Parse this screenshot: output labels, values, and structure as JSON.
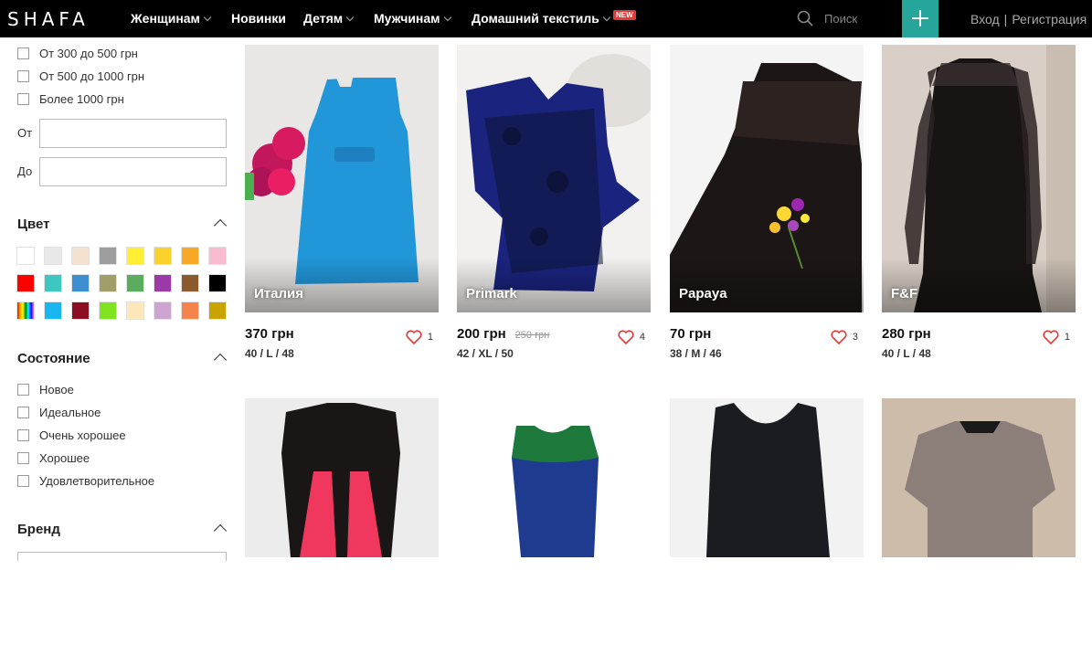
{
  "header": {
    "logo": "SHAFA",
    "nav": [
      {
        "label": "Женщинам",
        "dropdown": true
      },
      {
        "label": "Новинки",
        "dropdown": false
      },
      {
        "label": "Детям",
        "dropdown": true
      },
      {
        "label": "Мужчинам",
        "dropdown": true
      },
      {
        "label": "Домашний текстиль",
        "dropdown": true
      }
    ],
    "new_badge": "NEW",
    "search_placeholder": "Поиск",
    "login": "Вход",
    "register": "Регистрация",
    "separator": "|"
  },
  "filters": {
    "price_options": [
      "От 300 до 500 грн",
      "От 500 до 1000 грн",
      "Более 1000 грн"
    ],
    "from_label": "От",
    "to_label": "До",
    "color_title": "Цвет",
    "colors": [
      "#ffffff",
      "#e8e8e8",
      "#f5e1cf",
      "#9e9e9e",
      "#ffee33",
      "#fbd12c",
      "#f9a825",
      "#f8bbd0",
      "#ff0000",
      "#3ec6c0",
      "#3c8fd0",
      "#a19e6a",
      "#5aad5f",
      "#9b3aa6",
      "#8a5a2c",
      "#000000",
      "rainbow",
      "#1ab6f0",
      "#8d0d23",
      "#7fe321",
      "#fde6b8",
      "#cda5d0",
      "#f5834c",
      "#c9a400"
    ],
    "condition_title": "Состояние",
    "conditions": [
      "Новое",
      "Идеальное",
      "Очень хорошее",
      "Хорошее",
      "Удовлетворительное"
    ],
    "brand_title": "Бренд"
  },
  "products": [
    {
      "brand": "Италия",
      "price": "370 грн",
      "old_price": "",
      "size": "40 / L / 48",
      "likes": "1"
    },
    {
      "brand": "Primark",
      "price": "200 грн",
      "old_price": "250 грн",
      "size": "42 / XL / 50",
      "likes": "4"
    },
    {
      "brand": "Papaya",
      "price": "70 грн",
      "old_price": "",
      "size": "38 / M / 46",
      "likes": "3"
    },
    {
      "brand": "F&F",
      "price": "280 грн",
      "old_price": "",
      "size": "40 / L / 48",
      "likes": "1"
    },
    {
      "brand": "",
      "price": "",
      "old_price": "",
      "size": "",
      "likes": ""
    },
    {
      "brand": "",
      "price": "",
      "old_price": "",
      "size": "",
      "likes": ""
    },
    {
      "brand": "",
      "price": "",
      "old_price": "",
      "size": "",
      "likes": ""
    },
    {
      "brand": "",
      "price": "",
      "old_price": "",
      "size": "",
      "likes": ""
    }
  ]
}
